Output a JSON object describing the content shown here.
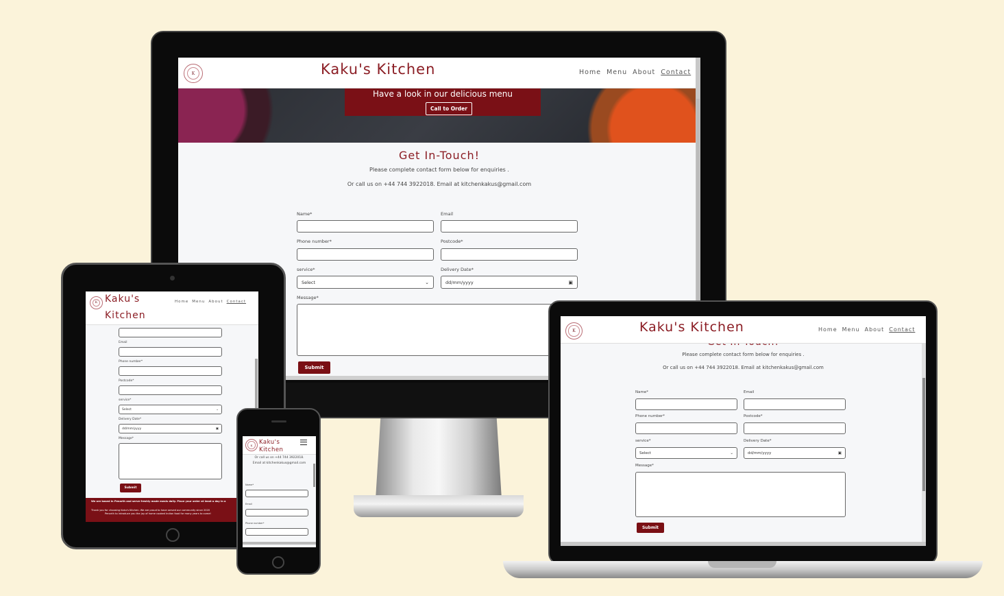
{
  "site": {
    "brand": "Kaku's Kitchen",
    "brand_line1": "Kaku's",
    "brand_line2": "Kitchen",
    "logo_text": "Kaku's Kitchen",
    "nav": [
      "Home",
      "Menu",
      "About",
      "Contact"
    ],
    "hero": {
      "text": "Have a look in our delicious menu",
      "button": "Call to Order"
    },
    "contact": {
      "title": "Get In-Touch!",
      "cut_title": "Get In-Touch!",
      "intro": "Please complete contact form below for enquiries .",
      "call_line": "Or call us on +44 744 3922018. Email at kitchenkakus@gmail.com",
      "call_line_a": "Or call us on +44 744 3922018.",
      "call_line_b": "Email at kitchenkakus@gmail.com"
    },
    "form": {
      "name": "Name*",
      "email": "Email",
      "phone": "Phone number*",
      "postcode": "Postcode*",
      "service": "service*",
      "service_value": "Select",
      "delivery": "Delivery Date*",
      "date_placeholder": "dd/mm/yyyy",
      "message": "Message*",
      "submit": "Submit"
    },
    "footer": {
      "line1": "We are based in Penarth and serve freshly made meals daily. Place your order at least a day in a",
      "line2": "Thank you for choosing Kaku's Kitchen. We are proud to have served our community since 2020",
      "line3": "Penarth to introduce you the joy of home cooked Indian food for many years to come!"
    }
  },
  "colors": {
    "background": "#fbf3da",
    "brand": "#8b1d24",
    "button": "#7a0f14"
  },
  "icons": {
    "menu": "hamburger-icon",
    "calendar": "calendar-icon",
    "dropdown": "chevron-down-icon"
  }
}
